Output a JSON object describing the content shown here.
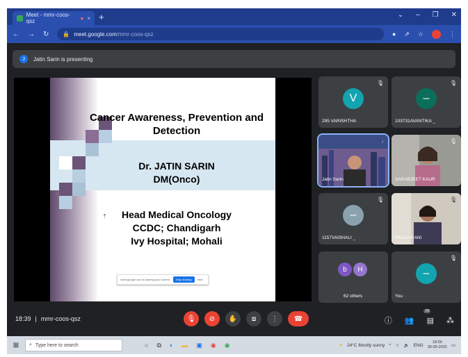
{
  "browser": {
    "tab_title": "Meet - mmr-coos-qsz",
    "tab_close": "×",
    "new_tab": "+",
    "url_host": "meet.google.com",
    "url_path": "/mmr-coos-qsz"
  },
  "presenting": {
    "initial": "J",
    "text": "Jatin Sarin is presenting"
  },
  "slide": {
    "title_line1": "Cancer Awareness, Prevention and",
    "title_line2": "Detection",
    "name_line1": "Dr. JATIN SARIN",
    "name_line2": "DM(Onco)",
    "pos_line1": "Head Medical Oncology",
    "pos_line2": "CCDC; Chandigarh",
    "pos_line3": "Ivy Hospital; Mohali",
    "notice_text": "meet.google.com is sharing your screen.",
    "notice_button": "Stop sharing",
    "notice_hide": "Hide"
  },
  "participants": [
    {
      "name": "295 VARISHTHA",
      "initial": "V",
      "color": "#12a4af"
    },
    {
      "name": "103731AVANTIKA _",
      "initial": "–",
      "color": "#0b6e5a"
    },
    {
      "name": "Jatin Sarin",
      "initial": "",
      "color": "#4a5a8a"
    },
    {
      "name": "SARABJEET KAUR",
      "initial": "",
      "color": "#8a8a84"
    },
    {
      "name": "1157VAISHALI _",
      "initial": "–",
      "color": "#8aa1ae"
    },
    {
      "name": "PALLVI RANI",
      "initial": "",
      "color": "#6b5a4e"
    },
    {
      "name": "62 others",
      "initial_a": "b",
      "initial_b": "H",
      "color_a": "#7e57c2",
      "color_b": "#9575cd"
    },
    {
      "name": "You",
      "initial": "–",
      "color": "#12a4af"
    }
  ],
  "bottombar": {
    "time": "18:39",
    "separator": "|",
    "meeting_code": "mmr-coos-qsz",
    "people_count": "70"
  },
  "taskbar": {
    "search_placeholder": "Type here to search",
    "weather": "24°C Mostly sunny",
    "lang": "ENG",
    "time": "18:39",
    "date": "30-05-2022"
  },
  "colors": {
    "accent_red": "#ea4335",
    "meet_bg": "#202124",
    "tile_bg": "#3c4043",
    "chrome_blue": "#2b4fae"
  }
}
